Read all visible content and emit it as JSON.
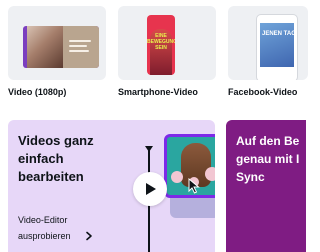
{
  "templates": [
    {
      "label": "Video (1080p)"
    },
    {
      "label": "Smartphone-Video",
      "thumb_text": "EINE BEWEGUNG SEIN"
    },
    {
      "label": "Facebook-Video",
      "thumb_text": "JENEN TAG"
    }
  ],
  "banner_editor": {
    "title": "Videos ganz einfach bearbeiten",
    "cta": "Video-Editor ausprobieren",
    "colors": {
      "background": "#e7d7f8",
      "accent": "#7d2ae8"
    }
  },
  "banner_sync": {
    "title": "Auf den Be\ngenau mit I\nSync",
    "colors": {
      "background": "#7f1c83"
    }
  }
}
